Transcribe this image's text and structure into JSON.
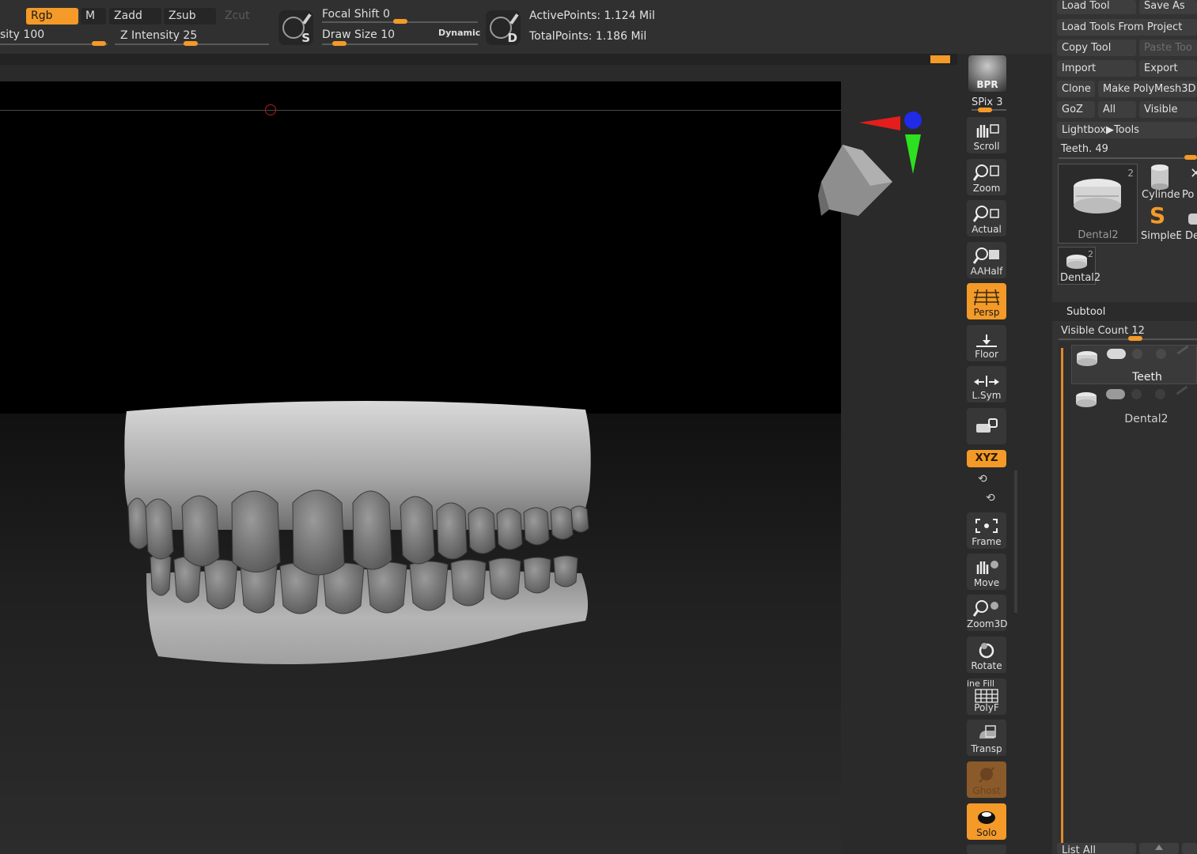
{
  "topbar": {
    "rgb": "Rgb",
    "m": "M",
    "zadd": "Zadd",
    "zsub": "Zsub",
    "zcut": "Zcut",
    "rgb_intensity": "sity 100",
    "z_intensity": "Z Intensity 25",
    "focal_shift": "Focal Shift 0",
    "draw_size": "Draw Size 10",
    "dynamic": "Dynamic",
    "s_letter": "S",
    "d_letter": "D",
    "active_points": "ActivePoints: 1.124 Mil",
    "total_points": "TotalPoints: 1.186 Mil",
    "accent": "#f39a28"
  },
  "shelf": {
    "bpr": "BPR",
    "spix": "SPix 3",
    "scroll": "Scroll",
    "zoom": "Zoom",
    "actual": "Actual",
    "aahalf": "AAHalf",
    "persp": "Persp",
    "floor": "Floor",
    "lsym": "L.Sym",
    "xyz": "XYZ",
    "frame": "Frame",
    "move": "Move",
    "zoom3d": "Zoom3D",
    "rotate": "Rotate",
    "line_fill": "ine Fill",
    "polyf": "PolyF",
    "transp": "Transp",
    "ghost": "Ghost",
    "solo": "Solo"
  },
  "tool_panel": {
    "load_tool": "Load Tool",
    "save_as": "Save As",
    "load_tools_from_project": "Load Tools From Project",
    "copy_tool": "Copy Tool",
    "paste_tool": "Paste Too",
    "import": "Import",
    "export": "Export",
    "clone": "Clone",
    "make_polymesh": "Make PolyMesh3D",
    "goz": "GoZ",
    "all": "All",
    "visible": "Visible",
    "lightbox_tools": "Lightbox▶Tools",
    "current_tool": "Teeth. 49",
    "thumb_main_label": "Dental2",
    "thumb_main_count": "2",
    "thumb_cylinder": "Cylinde",
    "thumb_po": "Po",
    "thumb_simple": "SimpleE",
    "thumb_de": "De",
    "thumb_small_label": "Dental2",
    "thumb_small_count": "2"
  },
  "subtool": {
    "title": "Subtool",
    "visible_count": "Visible Count 12",
    "items": [
      {
        "name": "Teeth"
      },
      {
        "name": "Dental2"
      }
    ],
    "list_all": "List All"
  }
}
